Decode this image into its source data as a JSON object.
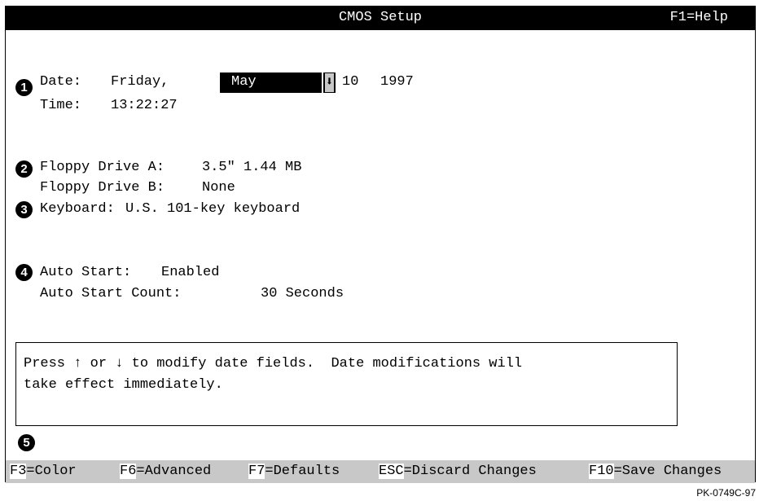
{
  "header": {
    "title": "CMOS Setup",
    "help": "F1=Help"
  },
  "date": {
    "label": "Date:",
    "weekday": "Friday,",
    "month": "May",
    "spinner_icon": "down-arrow-icon",
    "day": "10",
    "year": "1997"
  },
  "time": {
    "label": "Time:",
    "value": "13:22:27"
  },
  "floppy_a": {
    "label": "Floppy Drive A:",
    "value": "3.5\" 1.44 MB"
  },
  "floppy_b": {
    "label": "Floppy Drive B:",
    "value": "None"
  },
  "keyboard": {
    "label": "Keyboard:",
    "value": "U.S. 101-key keyboard"
  },
  "auto_start": {
    "label": "Auto Start:",
    "value": "Enabled"
  },
  "auto_start_count": {
    "label": "Auto Start Count:",
    "value": "30 Seconds"
  },
  "help_box": {
    "line1": "Press ↑ or ↓ to modify date fields.  Date modifications will",
    "line2": "take effect immediately."
  },
  "callouts": [
    "1",
    "2",
    "3",
    "4",
    "5"
  ],
  "function_keys": [
    {
      "key": "F3",
      "label": "=Color"
    },
    {
      "key": "F6",
      "label": "=Advanced"
    },
    {
      "key": "F7",
      "label": "=Defaults"
    },
    {
      "key": "ESC",
      "label": "=Discard Changes"
    },
    {
      "key": "F10",
      "label": "=Save Changes"
    }
  ],
  "figure_code": "PK-0749C-97",
  "colors": {
    "title_bg": "#000000",
    "title_fg": "#ffffff",
    "fkey_bar_bg": "#c8c8c8",
    "highlight_bg": "#000000"
  }
}
